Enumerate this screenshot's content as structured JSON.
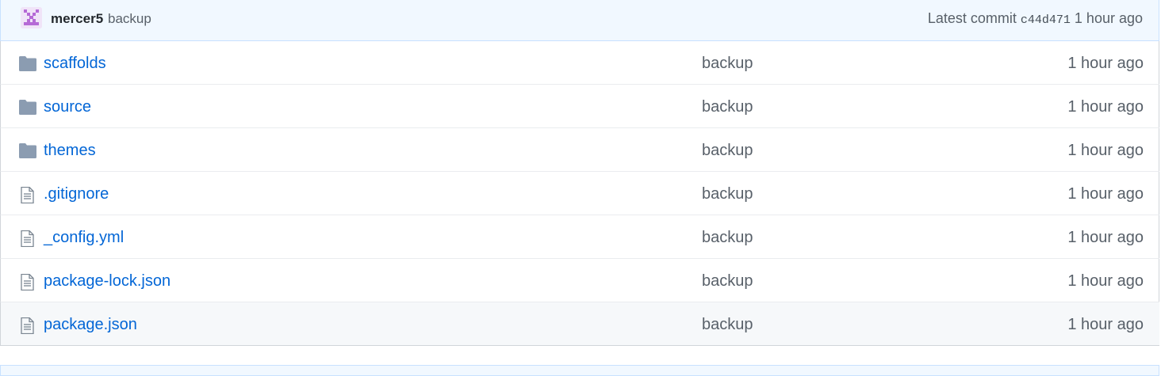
{
  "commit": {
    "author": "mercer5",
    "message": "backup",
    "latest_label": "Latest commit",
    "sha": "c44d471",
    "age": "1 hour ago"
  },
  "colors": {
    "link": "#0366d6",
    "muted": "#586069",
    "folder_icon": "#79b8ff",
    "header_bg": "#f1f8ff"
  },
  "files": [
    {
      "name": "scaffolds",
      "type": "folder",
      "icon": "folder-icon",
      "message": "backup",
      "age": "1 hour ago"
    },
    {
      "name": "source",
      "type": "folder",
      "icon": "folder-icon",
      "message": "backup",
      "age": "1 hour ago"
    },
    {
      "name": "themes",
      "type": "folder",
      "icon": "folder-icon",
      "message": "backup",
      "age": "1 hour ago"
    },
    {
      "name": ".gitignore",
      "type": "file",
      "icon": "file-icon",
      "message": "backup",
      "age": "1 hour ago"
    },
    {
      "name": "_config.yml",
      "type": "file",
      "icon": "file-icon",
      "message": "backup",
      "age": "1 hour ago"
    },
    {
      "name": "package-lock.json",
      "type": "file",
      "icon": "file-icon",
      "message": "backup",
      "age": "1 hour ago"
    },
    {
      "name": "package.json",
      "type": "file",
      "icon": "file-icon",
      "message": "backup",
      "age": "1 hour ago"
    }
  ]
}
